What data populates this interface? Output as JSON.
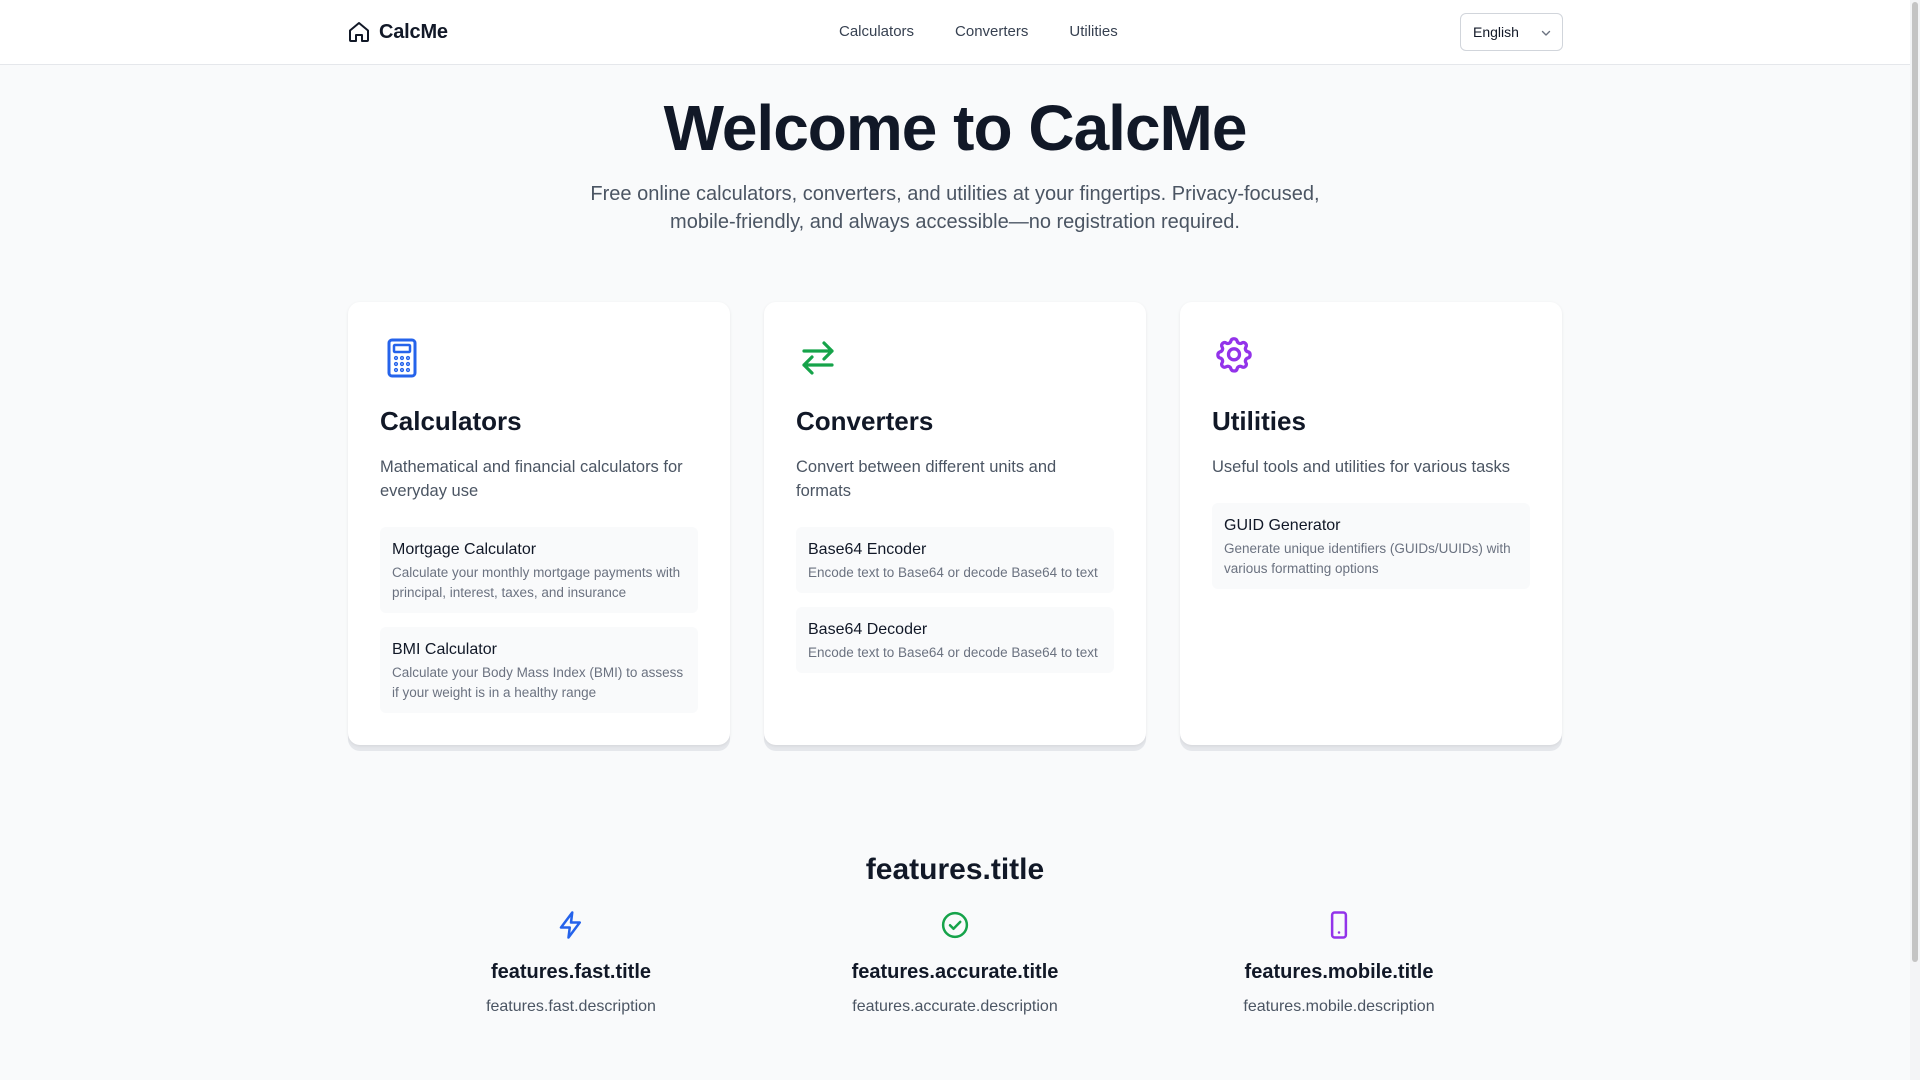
{
  "header": {
    "brand": "CalcMe",
    "nav": [
      "Calculators",
      "Converters",
      "Utilities"
    ],
    "language": "English"
  },
  "hero": {
    "title": "Welcome to CalcMe",
    "subtitle": "Free online calculators, converters, and utilities at your fingertips. Privacy-focused, mobile-friendly, and always accessible—no registration required."
  },
  "cards": [
    {
      "icon": "calculator-icon",
      "color": "#2563eb",
      "title": "Calculators",
      "description": "Mathematical and financial calculators for everyday use",
      "items": [
        {
          "title": "Mortgage Calculator",
          "description": "Calculate your monthly mortgage payments with principal, interest, taxes, and insurance"
        },
        {
          "title": "BMI Calculator",
          "description": "Calculate your Body Mass Index (BMI) to assess if your weight is in a healthy range"
        }
      ]
    },
    {
      "icon": "arrows-exchange-icon",
      "color": "#16a34a",
      "title": "Converters",
      "description": "Convert between different units and formats",
      "items": [
        {
          "title": "Base64 Encoder",
          "description": "Encode text to Base64 or decode Base64 to text"
        },
        {
          "title": "Base64 Decoder",
          "description": "Encode text to Base64 or decode Base64 to text"
        }
      ]
    },
    {
      "icon": "gear-icon",
      "color": "#9333ea",
      "title": "Utilities",
      "description": "Useful tools and utilities for various tasks",
      "items": [
        {
          "title": "GUID Generator",
          "description": "Generate unique identifiers (GUIDs/UUIDs) with various formatting options"
        }
      ]
    }
  ],
  "features": {
    "title": "features.title",
    "items": [
      {
        "icon": "lightning-icon",
        "color": "#2563eb",
        "title": "features.fast.title",
        "description": "features.fast.description"
      },
      {
        "icon": "check-circle-icon",
        "color": "#16a34a",
        "title": "features.accurate.title",
        "description": "features.accurate.description"
      },
      {
        "icon": "mobile-phone-icon",
        "color": "#9333ea",
        "title": "features.mobile.title",
        "description": "features.mobile.description"
      }
    ]
  }
}
